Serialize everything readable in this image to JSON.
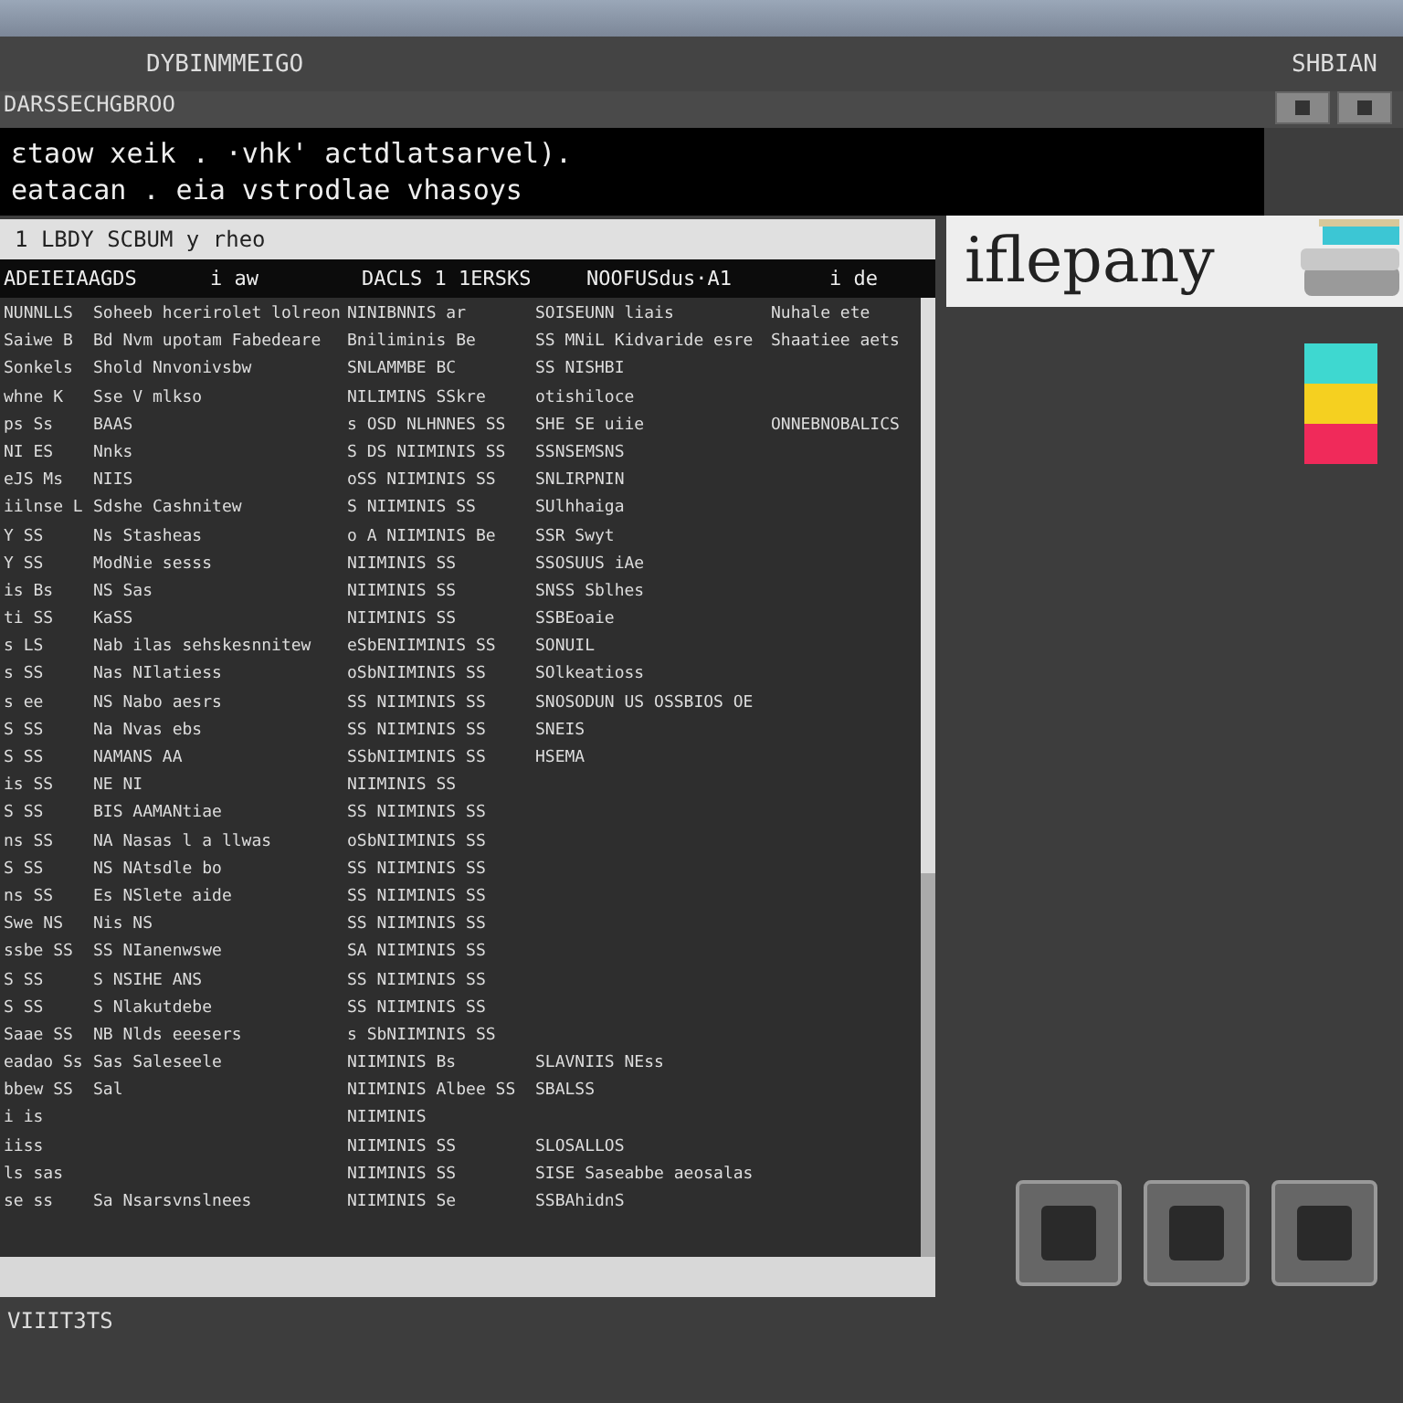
{
  "window": {
    "title": "DYBINMMEIGO",
    "right_label": "SHBIAN"
  },
  "subtitle": "DARSSECHGBROO",
  "terminal": {
    "lines": [
      "ɛtaow  xeik . ·vhk' actdlatsarvel).",
      "eatacan . eia  vstrodlae  vhasoys"
    ]
  },
  "list_window": {
    "title": "1 LBDY  SCBUM y rheo",
    "columns": [
      "ADEIEIAAGDS",
      "i aw",
      "DACLS 1 1ERSKS",
      "NOOFUSdus·A1",
      "i de"
    ],
    "rows": [
      [
        "NUNNLLS",
        "Soheeb hcerirolet lolreon",
        "NINIBNNIS ar",
        "SOISEUNN liais",
        "Nuhale ete"
      ],
      [
        "Saiwe B",
        "Bd Nvm upotam Fabedeare",
        "Bniliminis Be",
        "SS MNiL Kidvaride esre",
        "Shaatiee aets"
      ],
      [
        "Sonkels",
        "Shold  Nnvonivsbw",
        "SNLAMMBE BC",
        "SS NISHBI",
        ""
      ],
      [
        "whne K",
        "Sse V mlkso",
        "NILIMINS SSkre",
        "otishiloce",
        ""
      ],
      [
        "ps  Ss",
        "BAAS",
        "s OSD NLHNNES SS",
        "SHE SE uiie",
        "ONNEBNOBALICS"
      ],
      [
        "NI  ES",
        "Nnks",
        "S DS NIIMINIS SS",
        "SSNSEMSNS",
        ""
      ],
      [
        "eJS  Ms",
        "NIIS",
        "oSS NIIMINIS SS",
        "SNLIRPNIN",
        ""
      ],
      [
        "iilnse L",
        "Sdshe  Cashnitew",
        "S NIIMINIS SS",
        "SUlhhaiga",
        ""
      ],
      [
        "Y  SS",
        "Ns Stasheas",
        "o A NIIMINIS Be",
        "SSR Swyt",
        ""
      ],
      [
        "Y  SS",
        "ModNie  sesss",
        "NIIMINIS SS",
        "SSOSUUS iAe",
        ""
      ],
      [
        "is   Bs",
        "NS Sas",
        "NIIMINIS SS",
        "SNSS Sblhes",
        ""
      ],
      [
        "ti  SS",
        "KaSS",
        "NIIMINIS SS",
        "SSBEoaie",
        ""
      ],
      [
        "s  LS",
        "Nab  ilas  sehskesnnitew",
        "eSbENIIMINIS SS",
        "SONUIL",
        ""
      ],
      [
        "s  SS",
        "Nas  NIlatiess",
        "oSbNIIMINIS SS",
        "SOlkeatioss",
        ""
      ],
      [
        "s  ee",
        "NS  Nabo  aesrs",
        "SS NIIMINIS SS",
        "SNOSODUN  US  OSSBIOS OE",
        ""
      ],
      [
        "S  SS",
        "Na  Nvas  ebs",
        "SS NIIMINIS SS",
        "SNEIS",
        ""
      ],
      [
        "S  SS",
        "NAMANS  AA",
        "SSbNIIMINIS SS",
        "HSEMA",
        ""
      ],
      [
        "is  SS",
        "NE NI",
        "NIIMINIS SS",
        "",
        ""
      ],
      [
        "S  SS",
        "BIS  AAMANtiae",
        "SS NIIMINIS SS",
        "",
        ""
      ],
      [
        "ns  SS",
        "NA  Nasas  l  a  llwas",
        "oSbNIIMINIS SS",
        "",
        ""
      ],
      [
        "S  SS",
        "NS  NAtsdle  bo",
        "SS NIIMINIS SS",
        "",
        ""
      ],
      [
        "ns  SS",
        "Es  NSlete  aide",
        "SS NIIMINIS SS",
        "",
        ""
      ],
      [
        "Swe  NS",
        "Nis  NS",
        "SS NIIMINIS SS",
        "",
        ""
      ],
      [
        "ssbe  SS",
        "SS  NIanenwswe",
        "SA NIIMINIS SS",
        "",
        ""
      ],
      [
        "S  SS",
        "S  NSIHE  ANS",
        "SS NIIMINIS SS",
        "",
        ""
      ],
      [
        "S  SS",
        "S  Nlakutdebe",
        "SS NIIMINIS SS",
        "",
        ""
      ],
      [
        "Saae  SS",
        "NB  Nlds  eeesers",
        "s SbNIIMINIS SS",
        "",
        ""
      ],
      [
        "eadao  Ss",
        "Sas  Saleseele",
        "NIIMINIS Bs",
        "SLAVNIIS NEss",
        ""
      ],
      [
        "bbew  SS",
        "Sal",
        "NIIMINIS Albee SS",
        "SBALSS",
        ""
      ],
      [
        "i  is",
        "",
        "NIIMINIS",
        "",
        ""
      ],
      [
        "iiss",
        "",
        "NIIMINIS SS",
        "SLOSALLOS",
        ""
      ],
      [
        "ls  sas",
        "",
        "NIIMINIS SS",
        "SISE  Saseabbe  aeosalas",
        ""
      ],
      [
        "se  ss",
        "Sa  Nsarsvnslnees",
        "NIIMINIS Se",
        "SSBAhidnS",
        ""
      ]
    ],
    "status": "VIIIT3TS"
  },
  "brand": {
    "logo": "iflepany"
  },
  "swatches": [
    {
      "color": "#3ed8d0"
    },
    {
      "color": "#f5d020"
    },
    {
      "color": "#f02a5a"
    }
  ],
  "buttons": [
    {
      "kind": "square"
    },
    {
      "kind": "square"
    },
    {
      "kind": "square"
    }
  ]
}
